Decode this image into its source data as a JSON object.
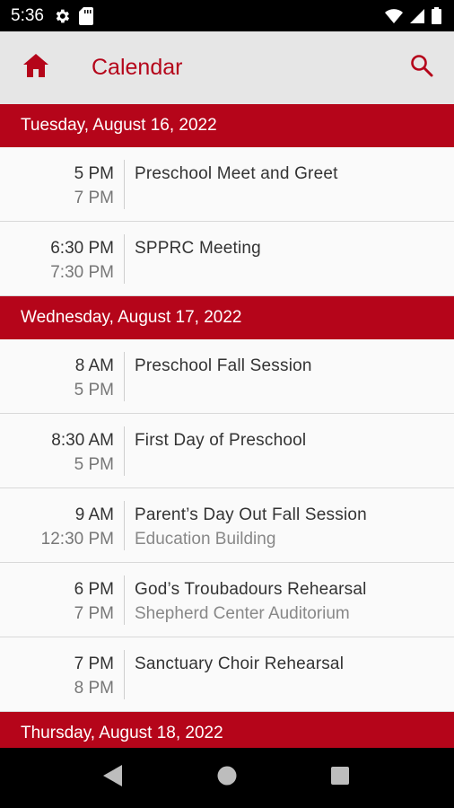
{
  "status_bar": {
    "time": "5:36",
    "icons": [
      "gear-icon",
      "sd-card-icon",
      "wifi-icon",
      "signal-icon",
      "battery-icon"
    ]
  },
  "app_bar": {
    "title": "Calendar",
    "home_icon": "home-icon",
    "search_icon": "search-icon",
    "accent_color": "#b5051a"
  },
  "days": [
    {
      "label": "Tuesday, August 16, 2022",
      "events": [
        {
          "start": "5 PM",
          "end": "7 PM",
          "title": "Preschool Meet and Greet",
          "location": ""
        },
        {
          "start": "6:30 PM",
          "end": "7:30 PM",
          "title": "SPPRC Meeting",
          "location": ""
        }
      ]
    },
    {
      "label": "Wednesday, August 17, 2022",
      "events": [
        {
          "start": "8 AM",
          "end": "5 PM",
          "title": "Preschool Fall Session",
          "location": ""
        },
        {
          "start": "8:30 AM",
          "end": "5 PM",
          "title": "First Day of Preschool",
          "location": ""
        },
        {
          "start": "9 AM",
          "end": "12:30 PM",
          "title": "Parent’s Day Out Fall Session",
          "location": "Education Building"
        },
        {
          "start": "6 PM",
          "end": "7 PM",
          "title": "God’s Troubadours Rehearsal",
          "location": "Shepherd Center Auditorium"
        },
        {
          "start": "7 PM",
          "end": "8 PM",
          "title": "Sanctuary Choir Rehearsal",
          "location": ""
        }
      ]
    },
    {
      "label": "Thursday, August 18, 2022",
      "events": []
    }
  ],
  "nav_bar": {
    "buttons": [
      "back-icon",
      "home-circle-icon",
      "recents-icon"
    ]
  }
}
